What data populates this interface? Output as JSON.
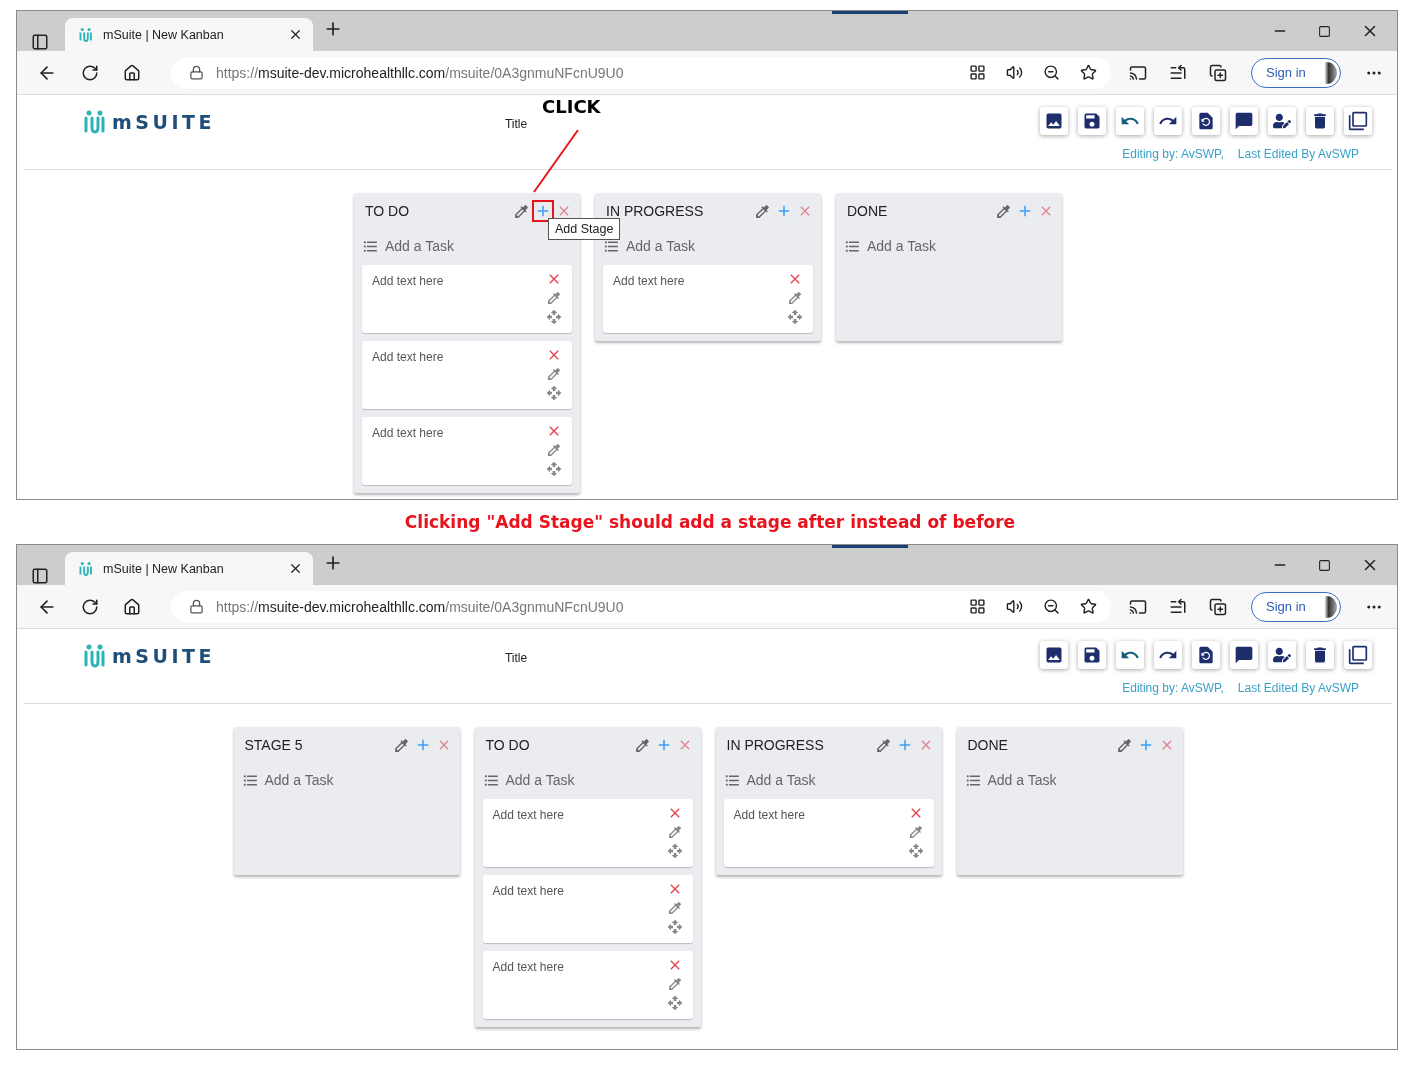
{
  "panels": [
    {
      "browser": {
        "tab_title": "mSuite | New Kanban",
        "url_scheme": "https://",
        "url_host": "msuite-dev.microhealthllc.com",
        "url_path": "/msuite/0A3gnmuNFcnU9U0",
        "sign_in": "Sign in"
      },
      "app": {
        "logo": "mSUITE",
        "title": "Title",
        "editing": "Editing by: AvSWP,",
        "last_edited": "Last Edited By AvSWP",
        "stages": [
          {
            "name": "TO DO",
            "add_task": "Add a Task",
            "highlighted": true,
            "callout": "CLICK",
            "tooltip": "Add Stage",
            "tasks": [
              {
                "text": "Add text here"
              },
              {
                "text": "Add text here"
              },
              {
                "text": "Add text here"
              }
            ]
          },
          {
            "name": "IN PROGRESS",
            "add_task": "Add a Task",
            "highlighted": false,
            "tasks": [
              {
                "text": "Add text here"
              }
            ]
          },
          {
            "name": "DONE",
            "add_task": "Add a Task",
            "highlighted": false
          }
        ]
      }
    },
    {
      "browser": {
        "tab_title": "mSuite | New Kanban",
        "url_scheme": "https://",
        "url_host": "msuite-dev.microhealthllc.com",
        "url_path": "/msuite/0A3gnmuNFcnU9U0",
        "sign_in": "Sign in"
      },
      "app": {
        "logo": "mSUITE",
        "title": "Title",
        "editing": "Editing by: AvSWP,",
        "last_edited": "Last Edited By AvSWP",
        "stages": [
          {
            "name": "STAGE 5",
            "add_task": "Add a Task",
            "highlighted": false
          },
          {
            "name": "TO DO",
            "add_task": "Add a Task",
            "highlighted": false,
            "tasks": [
              {
                "text": "Add text here"
              },
              {
                "text": "Add text here"
              },
              {
                "text": "Add text here"
              }
            ]
          },
          {
            "name": "IN PROGRESS",
            "add_task": "Add a Task",
            "highlighted": false,
            "tasks": [
              {
                "text": "Add text here"
              }
            ]
          },
          {
            "name": "DONE",
            "add_task": "Add a Task",
            "highlighted": false
          }
        ]
      }
    }
  ],
  "caption": "Clicking \"Add Stage\" should add a stage after instead of before"
}
